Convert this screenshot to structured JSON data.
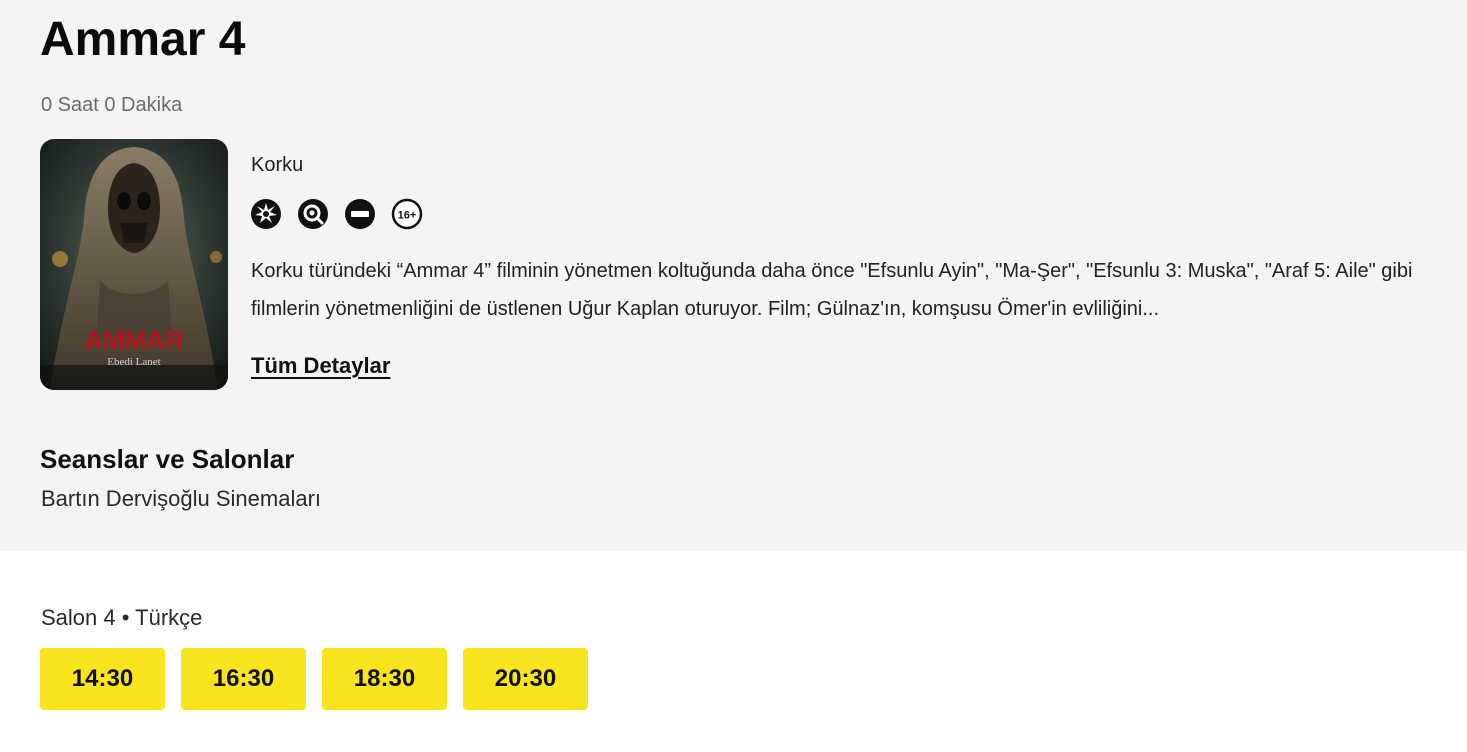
{
  "movie": {
    "title": "Ammar 4",
    "duration": "0 Saat 0 Dakika",
    "genre": "Korku",
    "rating_icons": [
      "violence-icon",
      "fear-icon",
      "negative-example-icon",
      "age-16-plus-icon"
    ],
    "age_badge": "16+",
    "synopsis": "Korku türündeki “Ammar 4” filminin yönetmen koltuğunda daha önce \"Efsunlu Ayin\", \"Ma-Şer\", \"Efsunlu 3: Muska\", \"Araf 5: Aile\" gibi filmlerin yönetmenliğini de üstlenen Uğur Kaplan oturuyor. Film; Gülnaz'ın, komşusu Ömer'in evliliğini...",
    "details_link": "Tüm Detaylar",
    "poster": {
      "title_text": "AMMAR",
      "subtitle_text": "Ebedi Lanet"
    }
  },
  "sessions": {
    "heading": "Seanslar ve Salonlar",
    "cinema": "Bartın Dervişoğlu Sinemaları",
    "hall": "Salon 4 • Türkçe",
    "times": [
      "14:30",
      "16:30",
      "18:30",
      "20:30"
    ]
  },
  "colors": {
    "panel_background": "#f4f4f4",
    "showtime_button": "#f9e51d",
    "poster_title": "#b3141a"
  }
}
